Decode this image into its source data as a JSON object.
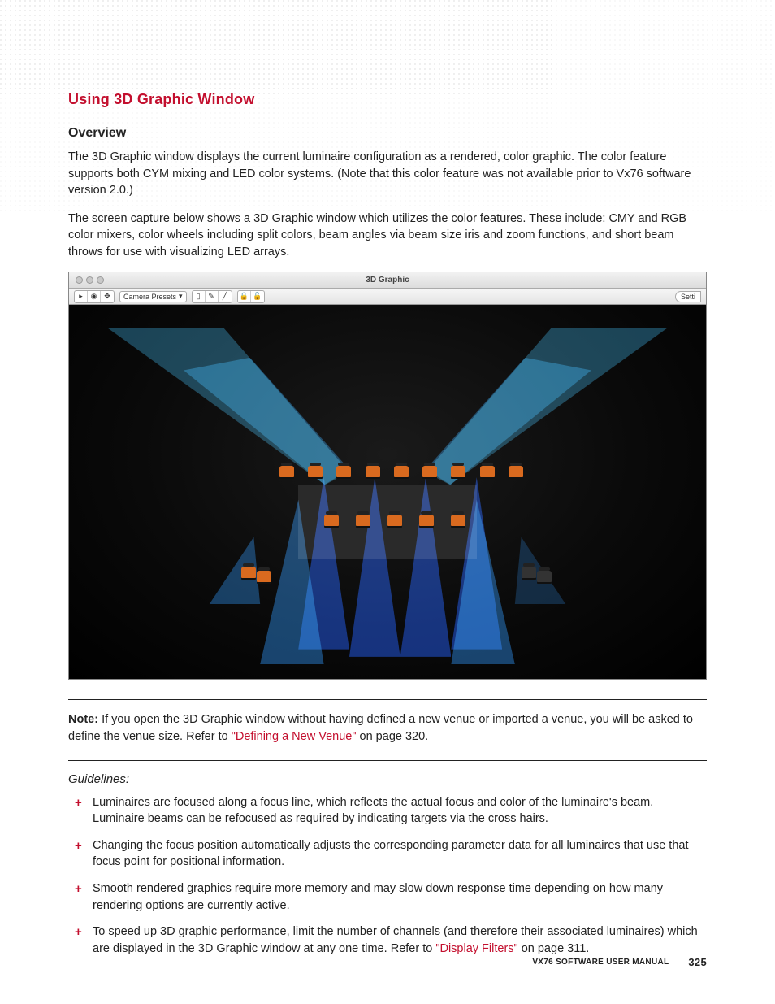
{
  "heading": "Using 3D Graphic Window",
  "subheading": "Overview",
  "para1": "The 3D Graphic window displays the current luminaire configuration as a rendered, color graphic. The color feature supports both CYM mixing and LED color systems. (Note that this color feature was not available prior to Vx76 software version 2.0.)",
  "para2": "The screen capture below shows a 3D Graphic window which utilizes the color features. These include: CMY and RGB color mixers, color wheels including split colors, beam angles via beam size iris and zoom functions, and short beam throws for use with visualizing LED arrays.",
  "screenshot": {
    "title": "3D Graphic",
    "presets_label": "Camera Presets",
    "settings_label": "Setti"
  },
  "note": {
    "label": "Note:",
    "before_link": "  If you open the 3D Graphic window without having defined a new venue or imported a venue, you will be asked to define the venue size. Refer to ",
    "link_text": "\"Defining a New Venue\"",
    "after_link": " on page 320."
  },
  "guidelines_heading": "Guidelines:",
  "guidelines": [
    {
      "text": "Luminaires are focused along a focus line, which reflects the actual focus and color of the luminaire's beam. Luminaire beams can be refocused as required by indicating targets via the cross hairs."
    },
    {
      "text": "Changing the focus position automatically adjusts the corresponding parameter data for all luminaires that use that focus point for positional information."
    },
    {
      "text": "Smooth rendered graphics require more memory and may slow down response time depending on how many rendering options are currently active."
    },
    {
      "text_before": "To speed up 3D graphic performance, limit the number of channels (and therefore their associated luminaires) which are displayed in the 3D Graphic window at any one time. Refer to ",
      "link": "\"Display Filters\"",
      "text_after": " on page 311."
    }
  ],
  "footer": {
    "manual": "VX76 SOFTWARE USER MANUAL",
    "page": "325"
  }
}
